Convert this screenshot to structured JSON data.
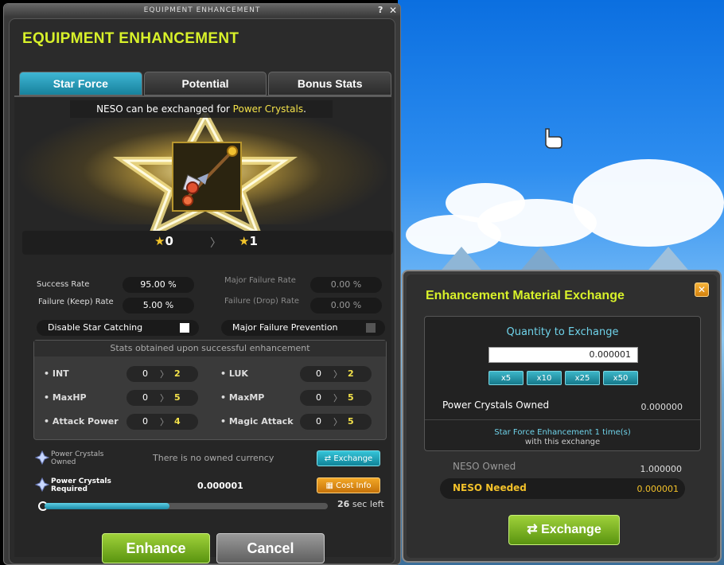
{
  "window": {
    "titlebar": "EQUIPMENT ENHANCEMENT",
    "title": "EQUIPMENT ENHANCEMENT",
    "help": "?",
    "close": "✕"
  },
  "tabs": [
    {
      "label": "Star Force",
      "active": true
    },
    {
      "label": "Potential",
      "active": false
    },
    {
      "label": "Bonus Stats",
      "active": false
    }
  ],
  "banner": {
    "prefix": "NESO can be exchanged for ",
    "highlight": "Power Crystals",
    "suffix": "."
  },
  "stars": {
    "from": "0",
    "to": "1",
    "arrow": "〉"
  },
  "rates": {
    "success_label": "Success Rate",
    "success_value": "95.00 %",
    "fail_keep_label": "Failure (Keep) Rate",
    "fail_keep_value": "5.00 %",
    "major_fail_label": "Major Failure Rate",
    "major_fail_value": "0.00 %",
    "fail_drop_label": "Failure (Drop) Rate",
    "fail_drop_value": "0.00 %"
  },
  "options": {
    "disable_star_catching": "Disable Star Catching",
    "major_failure_prevention": "Major Failure Prevention"
  },
  "stats": {
    "title": "Stats obtained upon successful enhancement",
    "items": [
      {
        "name": "• INT",
        "from": "0",
        "to": "2"
      },
      {
        "name": "• LUK",
        "from": "0",
        "to": "2"
      },
      {
        "name": "• MaxHP",
        "from": "0",
        "to": "5"
      },
      {
        "name": "• MaxMP",
        "from": "0",
        "to": "5"
      },
      {
        "name": "• Attack Power",
        "from": "0",
        "to": "4"
      },
      {
        "name": "• Magic Attack",
        "from": "0",
        "to": "5"
      }
    ],
    "arrow": "〉"
  },
  "currency": {
    "owned_label": "Power Crystals Owned",
    "owned_message": "There is no owned currency",
    "exchange_button": "Exchange",
    "required_label": "Power Crystals Required",
    "required_value": "0.000001",
    "cost_button": "Cost Info",
    "timer_number": "26",
    "timer_suffix": "sec left",
    "timer_progress": 0.44
  },
  "buttons": {
    "enhance": "Enhance",
    "cancel": "Cancel"
  },
  "dialog": {
    "title": "Enhancement Material Exchange",
    "close": "✕",
    "quantity_title": "Quantity to Exchange",
    "quantity_value": "0.000001",
    "multipliers": [
      "x5",
      "x10",
      "x25",
      "x50"
    ],
    "owned_label": "Power Crystals Owned",
    "owned_value": "0.000000",
    "result_line1": "Star Force Enhancement 1 time(s)",
    "result_line2": "with this exchange",
    "neso_owned_label": "NESO Owned",
    "neso_owned_value": "1.000000",
    "neso_needed_label": "NESO Needed",
    "neso_needed_value": "0.000001",
    "exchange_button": "Exchange"
  },
  "colors": {
    "title_yellow": "#d8f12a",
    "tab_active": "#17819c",
    "highlight_yellow": "#f4e24a",
    "neso_gold": "#f2c12a",
    "accent_cyan": "#6fd3ea",
    "green_button": "#5a9410",
    "orange_button": "#c6730a"
  },
  "icons": [
    "star-icon",
    "crystal-icon",
    "exchange-arrows-icon",
    "chart-icon",
    "clock-icon",
    "staff-weapon-icon",
    "hand-cursor-icon",
    "close-icon",
    "help-icon"
  ]
}
